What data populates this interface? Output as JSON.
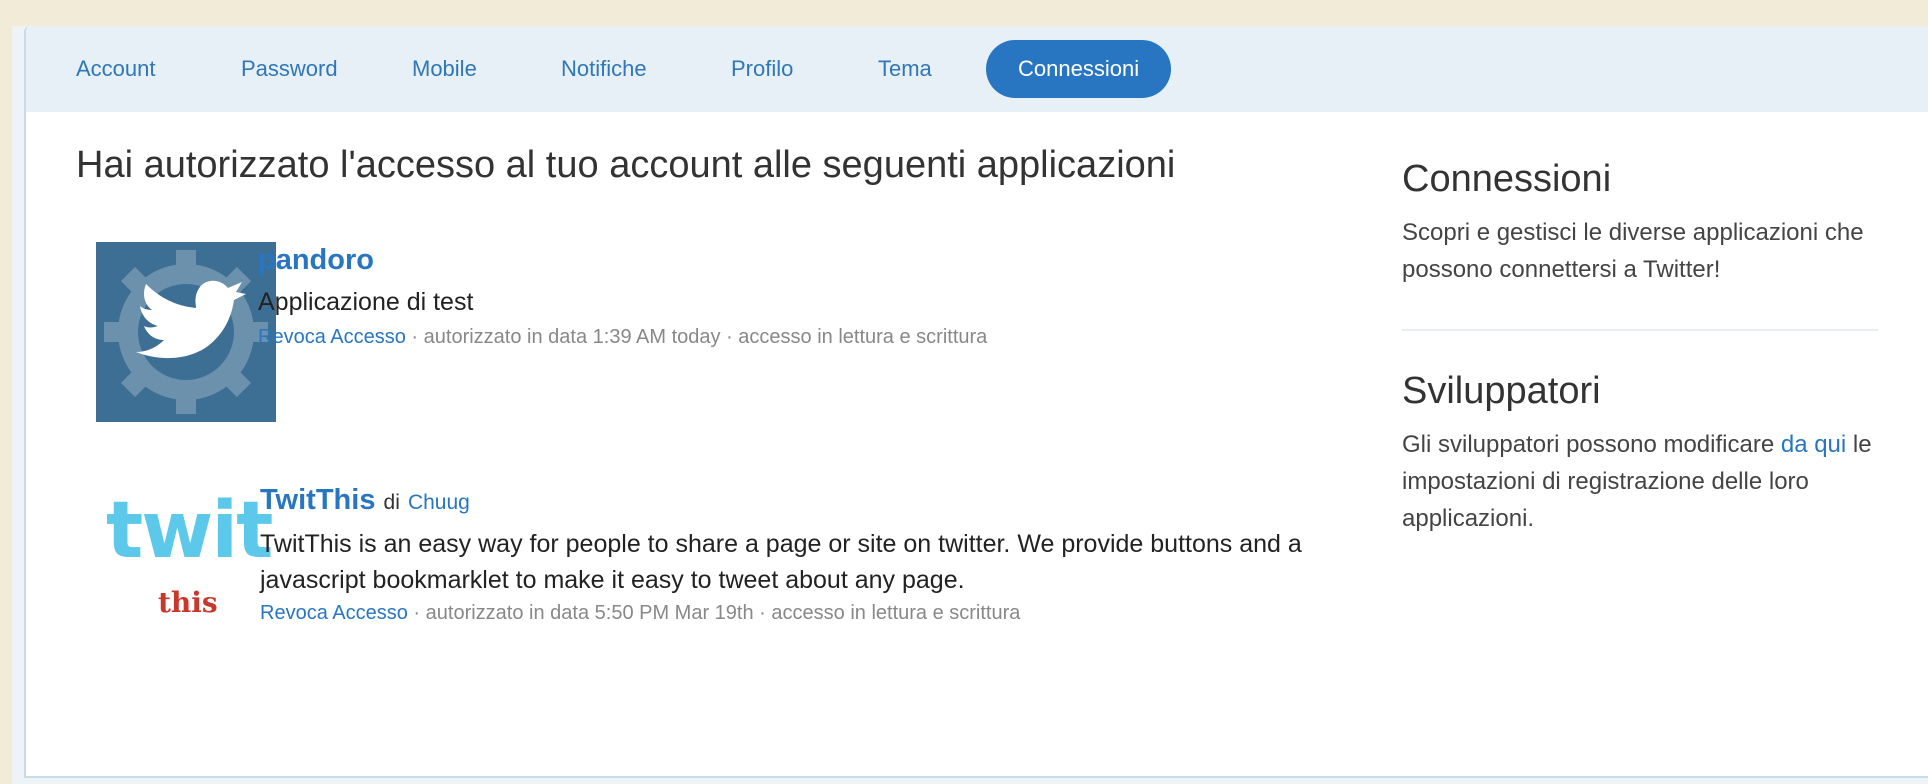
{
  "tabs": [
    {
      "label": "Account"
    },
    {
      "label": "Password"
    },
    {
      "label": "Mobile"
    },
    {
      "label": "Notifiche"
    },
    {
      "label": "Profilo"
    },
    {
      "label": "Tema"
    },
    {
      "label": "Connessioni",
      "active": true
    }
  ],
  "main": {
    "heading": "Hai autorizzato l'accesso al tuo account alle seguenti applicazioni",
    "apps": [
      {
        "name": "pandoro",
        "by": "",
        "author": "",
        "description": "Applicazione di test",
        "revoke_label": "Revoca Accesso",
        "authorized": "autorizzato in data 1:39 AM today",
        "access": "accesso in lettura e scrittura",
        "icon": "twitter-bird-gear-icon"
      },
      {
        "name": "TwitThis",
        "by": "di",
        "author": "Chuug",
        "description": "TwitThis is an easy way for people to share a page or site on twitter. We provide buttons and a javascript bookmarklet to make it easy to tweet about any page.",
        "revoke_label": "Revoca Accesso",
        "authorized": "autorizzato in data 5:50 PM Mar 19th",
        "access": "accesso in lettura e scrittura",
        "icon": "twitthis-logo",
        "logo_text": "twit",
        "logo_sub": "this"
      }
    ]
  },
  "sidebar": {
    "connections": {
      "title": "Connessioni",
      "text": "Scopri e gestisci le diverse applicazioni che possono connettersi a Twitter!"
    },
    "developers": {
      "title": "Sviluppatori",
      "text_before": "Gli sviluppatori possono modificare ",
      "link": "da qui",
      "text_after": " le impostazioni di registrazione delle loro applicazioni."
    }
  },
  "colors": {
    "accent": "#2876c2",
    "tabbar": "#e7f0f7",
    "page_bg": "#f2ebd8"
  }
}
